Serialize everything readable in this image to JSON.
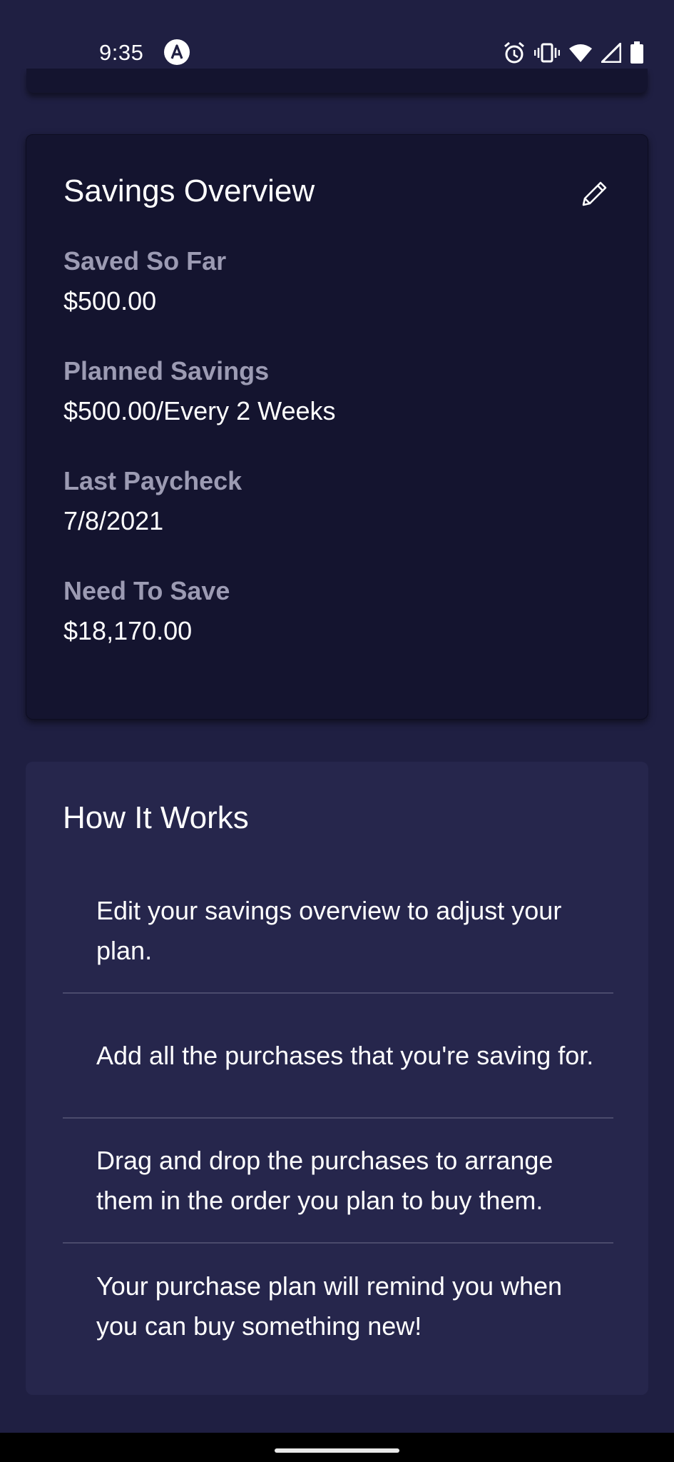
{
  "status_bar": {
    "time": "9:35",
    "icons": [
      "app-notification-icon",
      "alarm-icon",
      "vibrate-icon",
      "wifi-icon",
      "cell-signal-icon",
      "battery-icon"
    ]
  },
  "overview": {
    "title": "Savings Overview",
    "edit_icon": "pencil-icon",
    "fields": [
      {
        "label": "Saved So Far",
        "value": "$500.00"
      },
      {
        "label": "Planned Savings",
        "value": "$500.00/Every 2 Weeks"
      },
      {
        "label": "Last Paycheck",
        "value": "7/8/2021"
      },
      {
        "label": "Need To Save",
        "value": "$18,170.00"
      }
    ]
  },
  "how_it_works": {
    "title": "How It Works",
    "items": [
      "Edit your savings overview to adjust your plan.",
      "Add all the purchases that you're saving for.",
      "Drag and drop the purchases to arrange them in the order you plan to buy them.",
      "Your purchase plan will remind you when you can buy something new!"
    ]
  },
  "colors": {
    "background": "#1f1f42",
    "overview_card": "#14142f",
    "how_card": "#26264c",
    "label": "#9c9bb3"
  }
}
